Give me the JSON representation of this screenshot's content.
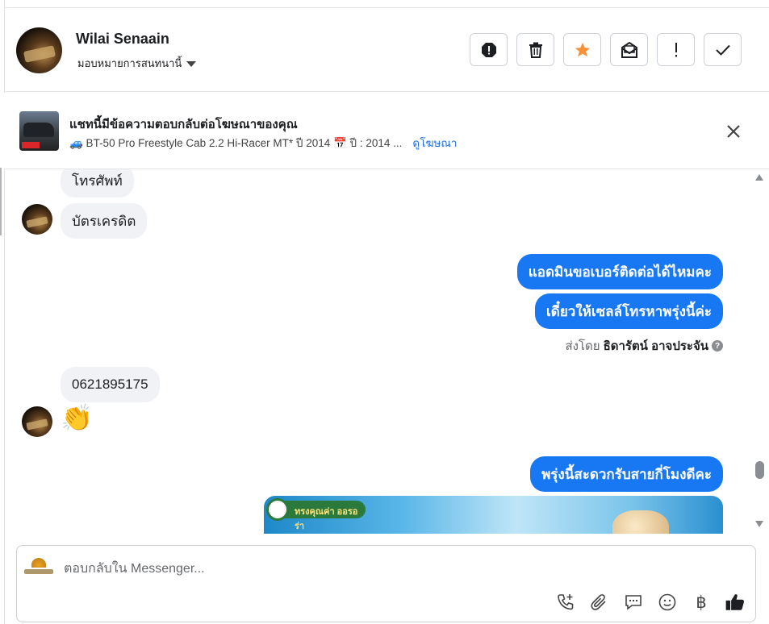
{
  "header": {
    "name": "Wilai Senaain",
    "assign_label": "มอบหมายการสนทนานี้",
    "actions": [
      {
        "icon": "alert-octagon-icon"
      },
      {
        "icon": "trash-icon"
      },
      {
        "icon": "star-icon",
        "color": "#f7923b"
      },
      {
        "icon": "mark-unread-icon"
      },
      {
        "icon": "exclamation-icon"
      },
      {
        "icon": "check-icon"
      }
    ]
  },
  "ad": {
    "title": "แชทนี้มีข้อความตอบกลับต่อโฆษณาของคุณ",
    "subtitle": "🚙 BT-50 Pro Freestyle Cab 2.2 Hi-Racer MT* ปี 2014 📅 ปี : 2014 ...",
    "link_label": "ดูโฆษณา"
  },
  "messages": {
    "in_1": "โทรศัพท์",
    "in_2": "บัตรเครดิต",
    "out_1": "แอดมินขอเบอร์ติดต่อได้ไหมคะ",
    "out_2": "เดี๋ยวให้เซลล์โทรหาพรุ่งนี้ค่ะ",
    "sent_by_prefix": "ส่งโดย",
    "sent_by_name": "ธิดารัตน์ อาจประจัน",
    "in_3": "0621895175",
    "in_4": "👏",
    "out_3": "พรุ่งนี้สะดวกรับสายกี่โมงดีคะ",
    "image_caption": "ทรงคุณค่า ออรอร่า"
  },
  "composer": {
    "placeholder": "ตอบกลับใน Messenger...",
    "tools": [
      {
        "icon": "phone-plus-icon"
      },
      {
        "icon": "paperclip-icon"
      },
      {
        "icon": "saved-reply-icon"
      },
      {
        "icon": "emoji-icon"
      },
      {
        "icon": "baht-icon",
        "glyph": "฿"
      },
      {
        "icon": "thumbs-up-icon"
      }
    ]
  },
  "colors": {
    "accent": "#1877f2",
    "link": "#216fdb",
    "star": "#f7923b"
  }
}
